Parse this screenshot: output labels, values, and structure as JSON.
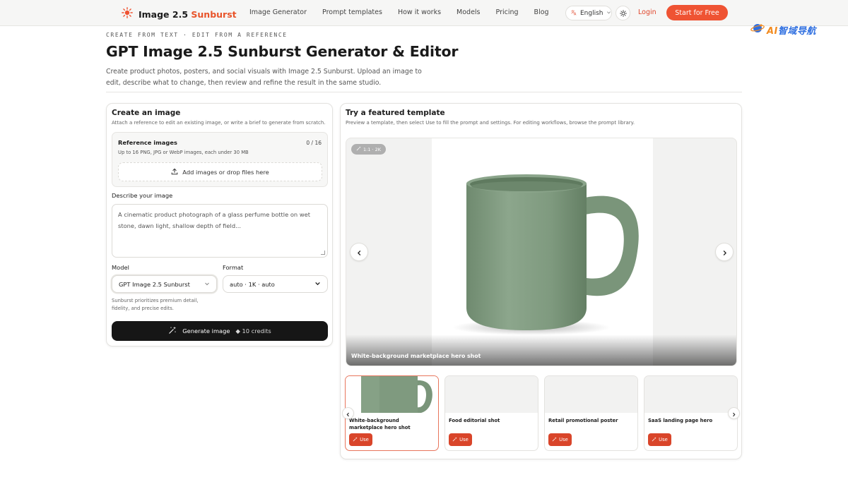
{
  "nav": {
    "brand_name": "Image 2.5",
    "brand_accent": "Sunburst",
    "links": [
      "Image Generator",
      "Prompt templates",
      "How it works",
      "Models",
      "Pricing",
      "Blog"
    ],
    "language": "English",
    "login": "Login",
    "cta": "Start for Free"
  },
  "watermark": {
    "ai": "AI",
    "text": "智域导航"
  },
  "header": {
    "eyebrow": "CREATE FROM TEXT · EDIT FROM A REFERENCE",
    "title": "GPT Image 2.5 Sunburst Generator & Editor",
    "subtitle": "Create product photos, posters, and social visuals with Image 2.5 Sunburst. Upload an image to edit, describe what to change, then review and refine the result in the same studio."
  },
  "create": {
    "title": "Create an image",
    "description": "Attach a reference to edit an existing image, or write a brief to generate from scratch.",
    "reference": {
      "title": "Reference images",
      "count": "0 / 16",
      "description": "Up to 16 PNG, JPG or WebP images, each under 30 MB",
      "upload_label": "Add images or drop files here"
    },
    "prompt_label": "Describe your image",
    "prompt_placeholder": "A cinematic product photograph of a glass perfume bottle on wet stone, dawn light, shallow depth of field...",
    "model_label": "Model",
    "model_value": "GPT Image 2.5 Sunburst",
    "format_label": "Format",
    "format_value": "auto · 1K · auto",
    "model_note": "Sunburst prioritizes premium detail, fidelity, and precise edits.",
    "generate_label": "Generate image",
    "credits": "◆ 10 credits"
  },
  "featured": {
    "title": "Try a featured template",
    "description": "Preview a template, then select Use to fill the prompt and settings. For editing workflows, browse the prompt library.",
    "ratio_chip": "1:1 · 2K",
    "hero_caption": "White-background marketplace hero shot",
    "templates": [
      {
        "title": "White-background marketplace hero shot",
        "use": "Use"
      },
      {
        "title": "Food editorial shot",
        "use": "Use"
      },
      {
        "title": "Retail promotional poster",
        "use": "Use"
      },
      {
        "title": "SaaS landing page hero",
        "use": "Use"
      }
    ]
  },
  "colors": {
    "accent": "#ef5333",
    "use_button": "#d9452a",
    "mug": "#7f9a7f",
    "dark_button": "#161616"
  },
  "icons": [
    "sun-logo-icon",
    "translate-icon",
    "chevron-down-icon",
    "sun-icon",
    "upload-icon",
    "magic-wand-icon",
    "chevron-left-icon",
    "chevron-right-icon",
    "sparkle-icon"
  ]
}
